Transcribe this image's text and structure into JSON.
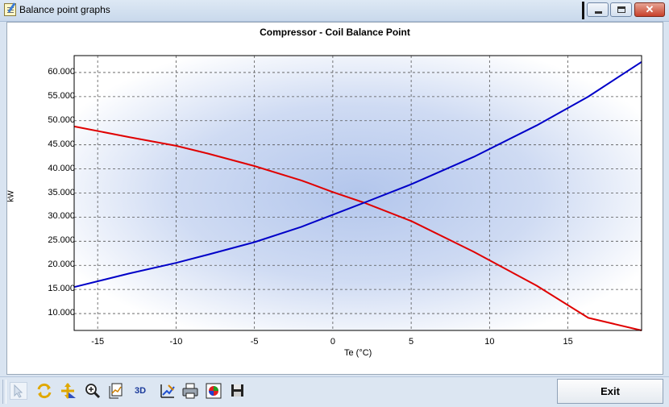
{
  "window": {
    "title": "Balance point graphs",
    "controls": [
      "minimize",
      "maximize",
      "close"
    ]
  },
  "toolbar": {
    "tools": [
      {
        "name": "pointer",
        "icon": "pointer-icon"
      },
      {
        "name": "rotate",
        "icon": "rotate-arrows-icon"
      },
      {
        "name": "move",
        "icon": "move-arrows-icon"
      },
      {
        "name": "zoom",
        "icon": "zoom-icon"
      },
      {
        "name": "copy",
        "icon": "copy-icon"
      },
      {
        "name": "3d",
        "label": "3D"
      },
      {
        "name": "edit",
        "icon": "chart-edit-icon"
      },
      {
        "name": "print",
        "icon": "printer-icon"
      },
      {
        "name": "export",
        "icon": "export-image-icon"
      },
      {
        "name": "save",
        "icon": "floppy-icon"
      }
    ],
    "exit_label": "Exit"
  },
  "chart_data": {
    "type": "line",
    "title": "Compressor - Coil Balance Point",
    "xlabel": "Te (°C)",
    "ylabel": "kW",
    "xlim": [
      -16.5,
      19.7
    ],
    "ylim": [
      6.5,
      63.5
    ],
    "x_ticks": [
      "-15",
      "-10",
      "-5",
      "0",
      "5",
      "10",
      "15"
    ],
    "y_ticks": [
      "10.000",
      "15.000",
      "20.000",
      "25.000",
      "30.000",
      "35.000",
      "40.000",
      "45.000",
      "50.000",
      "55.000",
      "60.000"
    ],
    "grid": true,
    "background": "radial gradient, light blue center",
    "series": [
      {
        "color": "#e00000",
        "x": [
          -16.5,
          -13,
          -10,
          -8,
          -5,
          -2,
          0,
          2,
          5,
          9,
          13,
          16.3,
          19.7
        ],
        "y": [
          48.8,
          46.6,
          44.8,
          43.2,
          40.6,
          37.6,
          35.2,
          33,
          29.2,
          22.8,
          15.8,
          9.1,
          6.5
        ]
      },
      {
        "color": "#0000c8",
        "x": [
          -16.5,
          -13,
          -10,
          -8,
          -5,
          -2,
          0,
          2,
          5,
          9,
          13,
          16.3,
          19.7
        ],
        "y": [
          15.5,
          18.3,
          20.5,
          22.2,
          24.8,
          28,
          30.5,
          33,
          36.8,
          42.5,
          49,
          55,
          62.2
        ]
      }
    ]
  }
}
